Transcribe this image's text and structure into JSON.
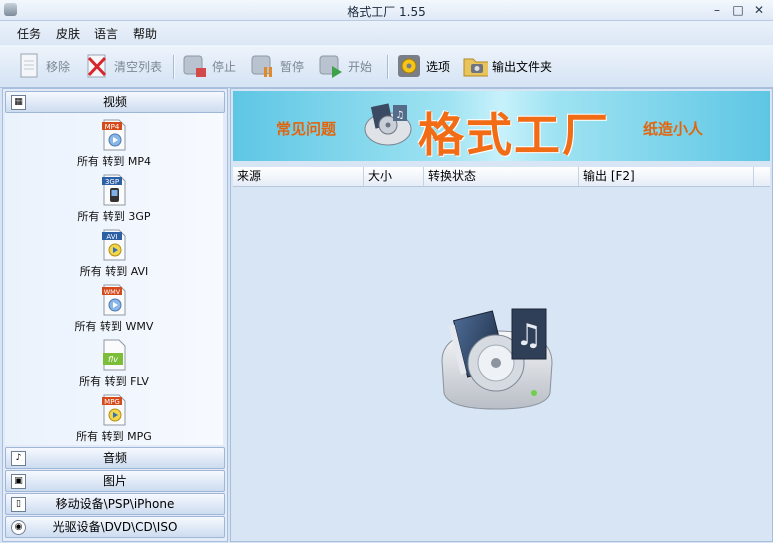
{
  "window": {
    "title": "格式工厂 1.55"
  },
  "menu": [
    "任务",
    "皮肤",
    "语言",
    "帮助"
  ],
  "toolbar": {
    "remove": "移除",
    "clear": "清空列表",
    "stop": "停止",
    "pause": "暂停",
    "start": "开始",
    "options": "选项",
    "output_folder": "输出文件夹"
  },
  "sidebar": {
    "video_header": "视频",
    "video_items": [
      {
        "badge": "MP4",
        "label": "所有 转到 MP4"
      },
      {
        "badge": "3GP",
        "label": "所有 转到 3GP"
      },
      {
        "badge": "AVI",
        "label": "所有 转到 AVI"
      },
      {
        "badge": "WMV",
        "label": "所有 转到 WMV"
      },
      {
        "badge": "flv",
        "label": "所有 转到 FLV"
      },
      {
        "badge": "MPG",
        "label": "所有 转到 MPG"
      }
    ],
    "audio_header": "音频",
    "image_header": "图片",
    "mobile_header": "移动设备\\PSP\\iPhone",
    "optical_header": "光驱设备\\DVD\\CD\\ISO"
  },
  "banner": {
    "faq": "常见问题",
    "title": "格式工厂",
    "author": "纸造小人"
  },
  "table": {
    "columns": [
      "来源",
      "大小",
      "转换状态",
      "输出 [F2]"
    ]
  },
  "colors": {
    "accent": "#f26b15",
    "banner_bg": "#9fe3f2"
  }
}
